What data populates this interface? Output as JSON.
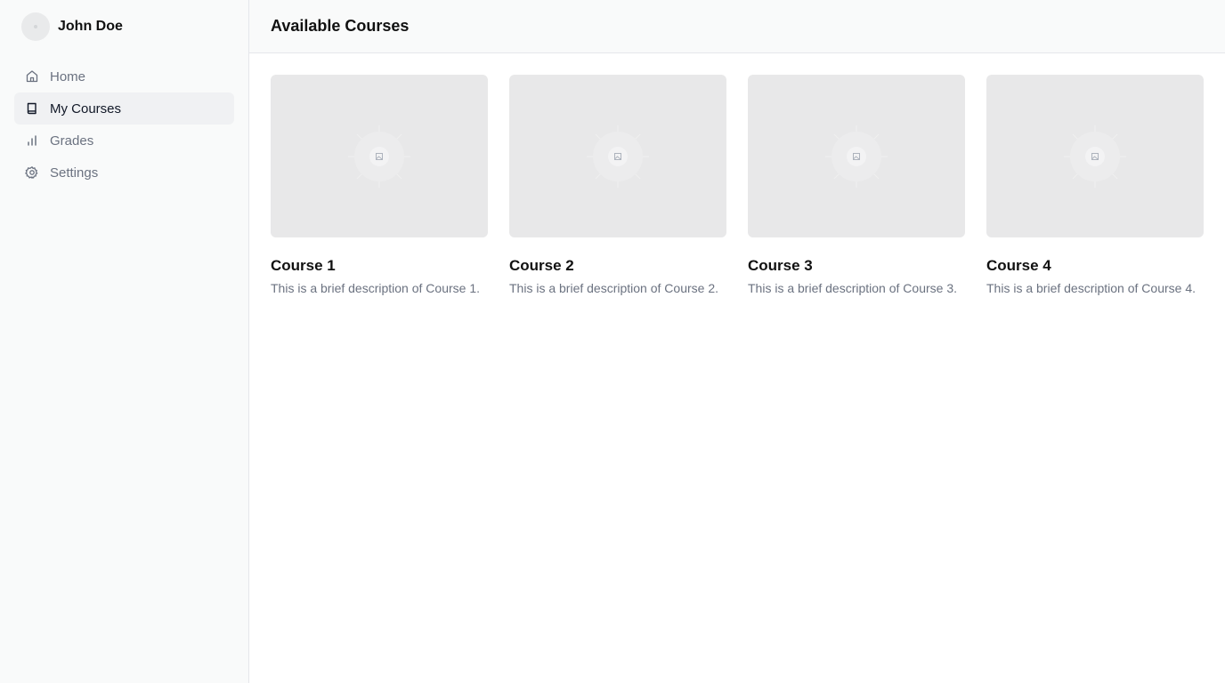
{
  "user": {
    "name": "John Doe"
  },
  "sidebar": {
    "items": [
      {
        "label": "Home",
        "icon": "home-icon",
        "active": false
      },
      {
        "label": "My Courses",
        "icon": "book-icon",
        "active": true
      },
      {
        "label": "Grades",
        "icon": "bar-chart-icon",
        "active": false
      },
      {
        "label": "Settings",
        "icon": "gear-icon",
        "active": false
      }
    ]
  },
  "header": {
    "title": "Available Courses"
  },
  "courses": [
    {
      "title": "Course 1",
      "description": "This is a brief description of Course 1.",
      "image": "image-placeholder-icon"
    },
    {
      "title": "Course 2",
      "description": "This is a brief description of Course 2.",
      "image": "image-placeholder-icon"
    },
    {
      "title": "Course 3",
      "description": "This is a brief description of Course 3.",
      "image": "image-placeholder-icon"
    },
    {
      "title": "Course 4",
      "description": "This is a brief description of Course 4.",
      "image": "image-placeholder-icon"
    }
  ],
  "colors": {
    "sidebar_bg": "#f9fafa",
    "active_item_bg": "#f0f1f3",
    "muted_text": "#6b7280",
    "placeholder_bg": "#e8e8e9"
  }
}
